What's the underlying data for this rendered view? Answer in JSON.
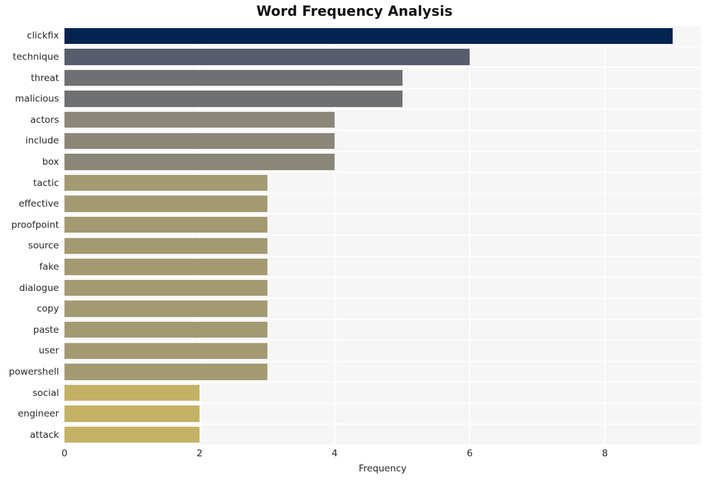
{
  "chart_data": {
    "type": "bar",
    "orientation": "horizontal",
    "title": "Word Frequency Analysis",
    "xlabel": "Frequency",
    "ylabel": "",
    "categories": [
      "clickfix",
      "technique",
      "threat",
      "malicious",
      "actors",
      "include",
      "box",
      "tactic",
      "effective",
      "proofpoint",
      "source",
      "fake",
      "dialogue",
      "copy",
      "paste",
      "user",
      "powershell",
      "social",
      "engineer",
      "attack"
    ],
    "values": [
      9,
      6,
      5,
      5,
      4,
      4,
      4,
      3,
      3,
      3,
      3,
      3,
      3,
      3,
      3,
      3,
      3,
      2,
      2,
      2
    ],
    "bar_colors": [
      "#04234e",
      "#585d6e",
      "#6e7072",
      "#6e7072",
      "#8a8779",
      "#8a8779",
      "#8a8779",
      "#a39a72",
      "#a39a72",
      "#a39a72",
      "#a39a72",
      "#a39a72",
      "#a39a72",
      "#a39a72",
      "#a39a72",
      "#a39a72",
      "#a39a72",
      "#c3b265",
      "#c3b265",
      "#c3b265"
    ],
    "xlim": [
      0,
      9.42
    ],
    "ylim": [
      -0.5,
      19.5
    ],
    "xticks": [
      0,
      2,
      4,
      6,
      8
    ],
    "xtick_labels": [
      "0",
      "2",
      "4",
      "6",
      "8"
    ],
    "grid": true,
    "grid_color": "#ffffff",
    "plot_background": "#f6f6f7",
    "figure_background": "#ffffff",
    "legend": null,
    "legend_position": "none"
  }
}
